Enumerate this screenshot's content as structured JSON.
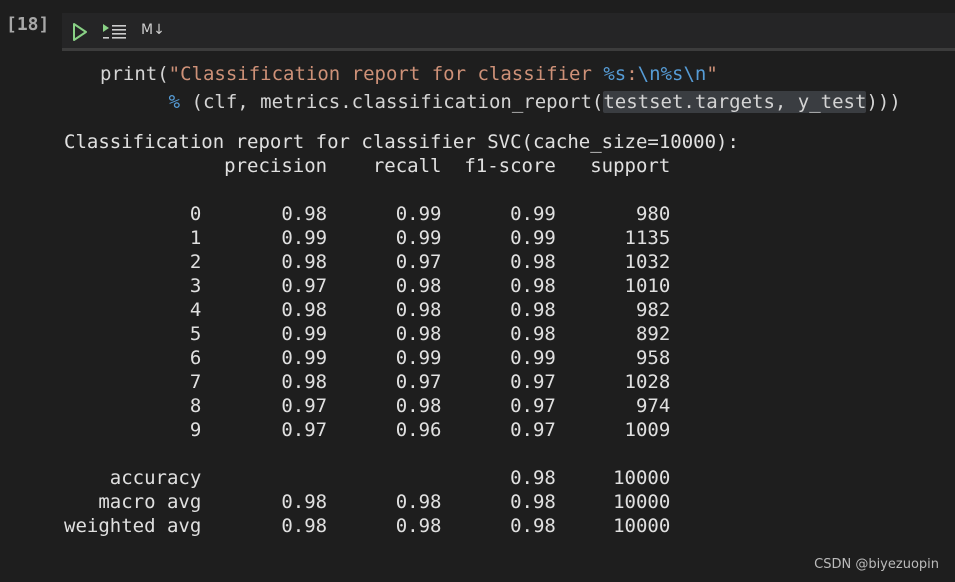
{
  "cell": {
    "execution_count": "[18]"
  },
  "toolbar": {
    "run_icon": "play-icon",
    "run_below_icon": "run-below-icon",
    "markdown_label": "M↓"
  },
  "code": {
    "l1_print": "print(",
    "l1_str1": "\"Classification report for classifier ",
    "l1_fmt1": "%s",
    "l1_str2": ":",
    "l1_esc1": "\\n",
    "l1_fmt2": "%s",
    "l1_esc2": "\\n",
    "l1_str3": "\"",
    "l2_indent": "      ",
    "l2_op": "%",
    "l2_mid": " (clf, metrics.classification_report(",
    "l2_hl": "testset.targets, y_test",
    "l2_end": ")))"
  },
  "output": {
    "text": "Classification report for classifier SVC(cache_size=10000):\n              precision    recall  f1-score   support\n\n           0       0.98      0.99      0.99       980\n           1       0.99      0.99      0.99      1135\n           2       0.98      0.97      0.98      1032\n           3       0.97      0.98      0.98      1010\n           4       0.98      0.98      0.98       982\n           5       0.99      0.98      0.98       892\n           6       0.99      0.99      0.99       958\n           7       0.98      0.97      0.97      1028\n           8       0.97      0.98      0.97       974\n           9       0.97      0.96      0.97      1009\n\n    accuracy                           0.98     10000\n   macro avg       0.98      0.98      0.98     10000\nweighted avg       0.98      0.98      0.98     10000"
  },
  "watermark": "CSDN @biyezuopin",
  "colors": {
    "background": "#1e1e1e",
    "run_green": "#89d185",
    "string": "#ce9178",
    "escape": "#569cd6"
  }
}
